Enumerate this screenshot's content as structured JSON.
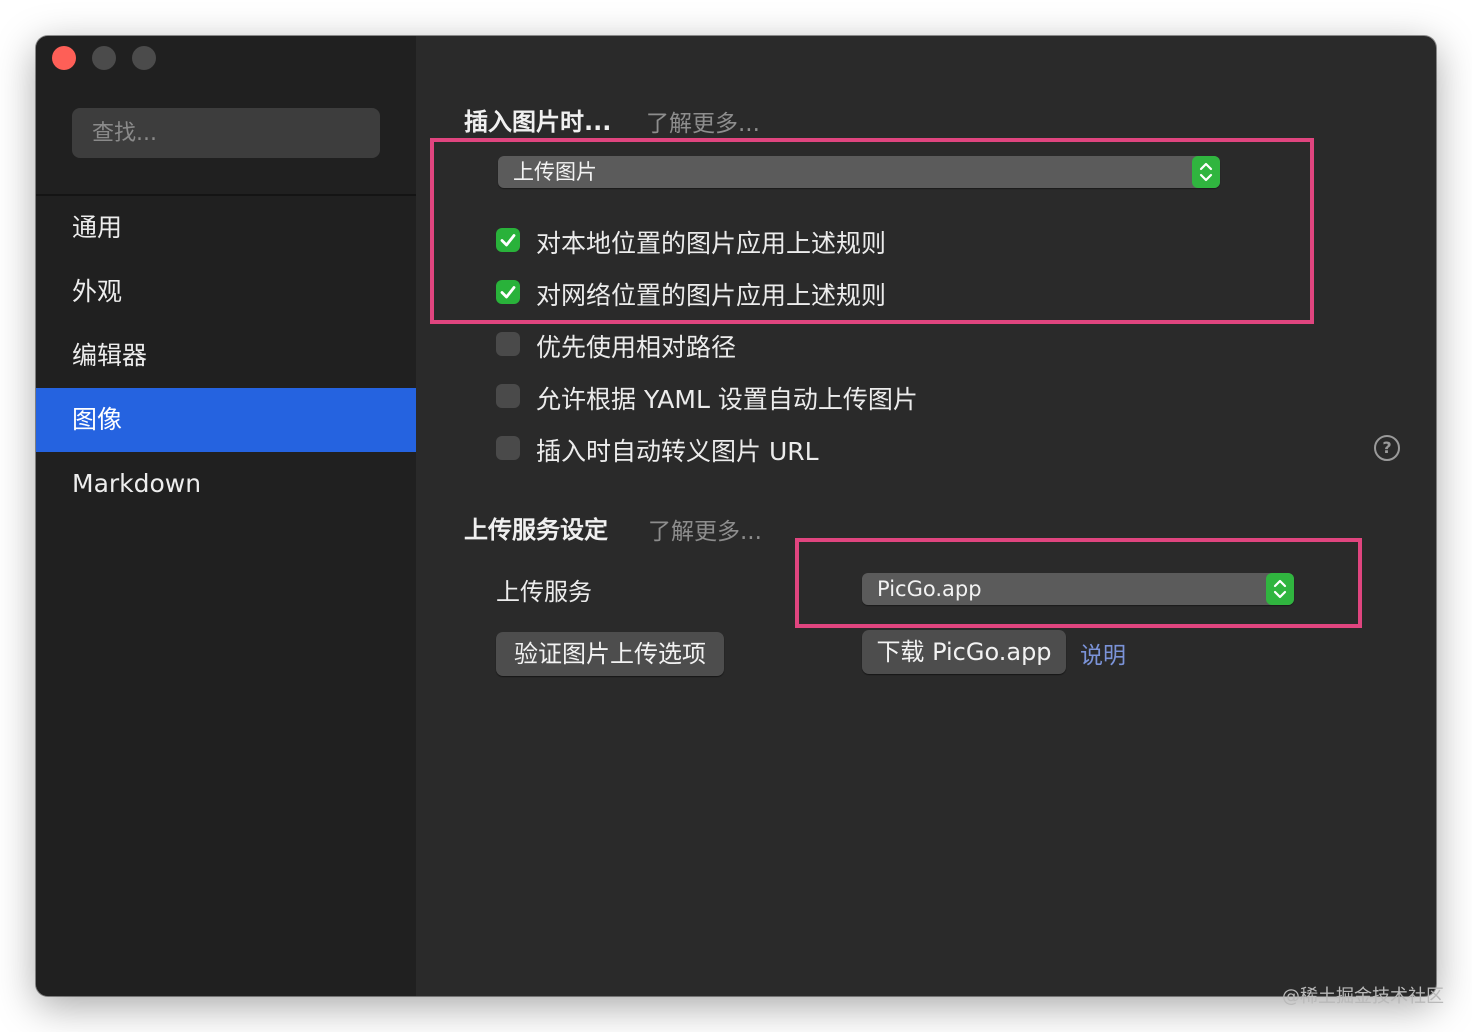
{
  "sidebar": {
    "search_placeholder": "查找...",
    "items": [
      {
        "label": "通用"
      },
      {
        "label": "外观"
      },
      {
        "label": "编辑器"
      },
      {
        "label": "图像"
      },
      {
        "label": "Markdown"
      }
    ],
    "active_item": "图像"
  },
  "insert_images": {
    "title": "插入图片时...",
    "learn_more": "了解更多...",
    "action_select": "上传图片",
    "options": [
      {
        "label": "对本地位置的图片应用上述规则",
        "checked": true
      },
      {
        "label": "对网络位置的图片应用上述规则",
        "checked": true
      },
      {
        "label": "优先使用相对路径",
        "checked": false
      },
      {
        "label": "允许根据 YAML 设置自动上传图片",
        "checked": false
      },
      {
        "label": "插入时自动转义图片 URL",
        "checked": false
      }
    ]
  },
  "upload_service": {
    "title": "上传服务设定",
    "learn_more": "了解更多...",
    "service_label": "上传服务",
    "service_select": "PicGo.app",
    "verify_button": "验证图片上传选项",
    "download_button": "下载 PicGo.app",
    "help_link": "说明"
  },
  "watermark": "@稀土掘金技术社区",
  "colors": {
    "accent": "#2563e0",
    "checkbox_checked": "#29b23a",
    "highlight_box": "#e0457f"
  }
}
